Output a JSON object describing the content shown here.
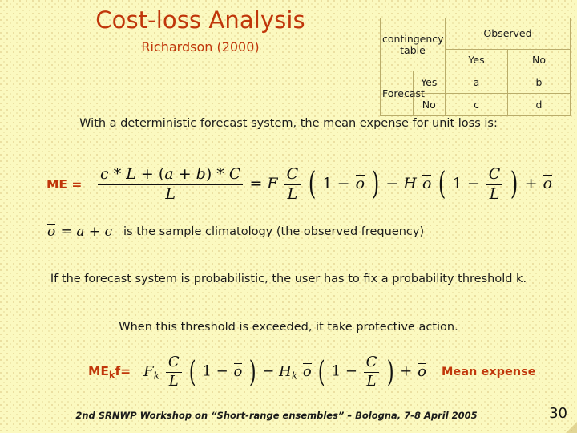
{
  "title": {
    "main": "Cost-loss Analysis",
    "subtitle": "Richardson (2000)",
    "color": "#c0360a"
  },
  "contingency_table": {
    "corner_label_line1": "contingency",
    "corner_label_line2": "table",
    "observed_header": "Observed",
    "observed_yes": "Yes",
    "observed_no": "No",
    "forecast_label": "Forecast",
    "forecast_yes": "Yes",
    "forecast_no": "No",
    "cell_a": "a",
    "cell_b": "b",
    "cell_c": "c",
    "cell_d": "d"
  },
  "body": {
    "deterministic_line": "With a deterministic forecast system, the mean expense for unit loss is:",
    "me_label": "ME =",
    "me_equation_plain": "(c*L + (a+b)*C)/L = F (C/L)(1 - ō) - H ō (1 - C/L) + ō",
    "me_numerator": "c * L + (a + b) * C",
    "me_denominator": "L",
    "climatology_equation_plain": "ō = a + c",
    "climatology_text": "is the sample climatology (the observed frequency)",
    "probabilistic_paragraph": "If the forecast system is probabilistic, the user has to fix a probability threshold k.",
    "threshold_line": "When this threshold is exceeded, it take protective action.",
    "mekf_label_base": "ME",
    "mekf_label_sub": "k",
    "mekf_label_tail": "f=",
    "mekf_equation_plain": "F_k (C/L)(1 - ō) - H_k ō (1 - C/L) + ō",
    "mean_expense_label": "Mean expense"
  },
  "math_symbols": {
    "c": "c",
    "L": "L",
    "a": "a",
    "b": "b",
    "C": "C",
    "F": "F",
    "H": "H",
    "o": "o",
    "k": "k",
    "one": "1",
    "star": "*",
    "plus": "+",
    "minus": "−",
    "equals": "=",
    "lparen": "(",
    "rparen": ")",
    "big_lparen": "(",
    "big_rparen": ")"
  },
  "footer": {
    "text": "2nd SRNWP Workshop on “Short-range ensembles” – Bologna, 7-8 April 2005",
    "page_number": "30"
  },
  "colors": {
    "background": "#fbf9c0",
    "accent": "#c0360a",
    "text": "#1a1a1a",
    "table_border": "#b9ac6a"
  }
}
